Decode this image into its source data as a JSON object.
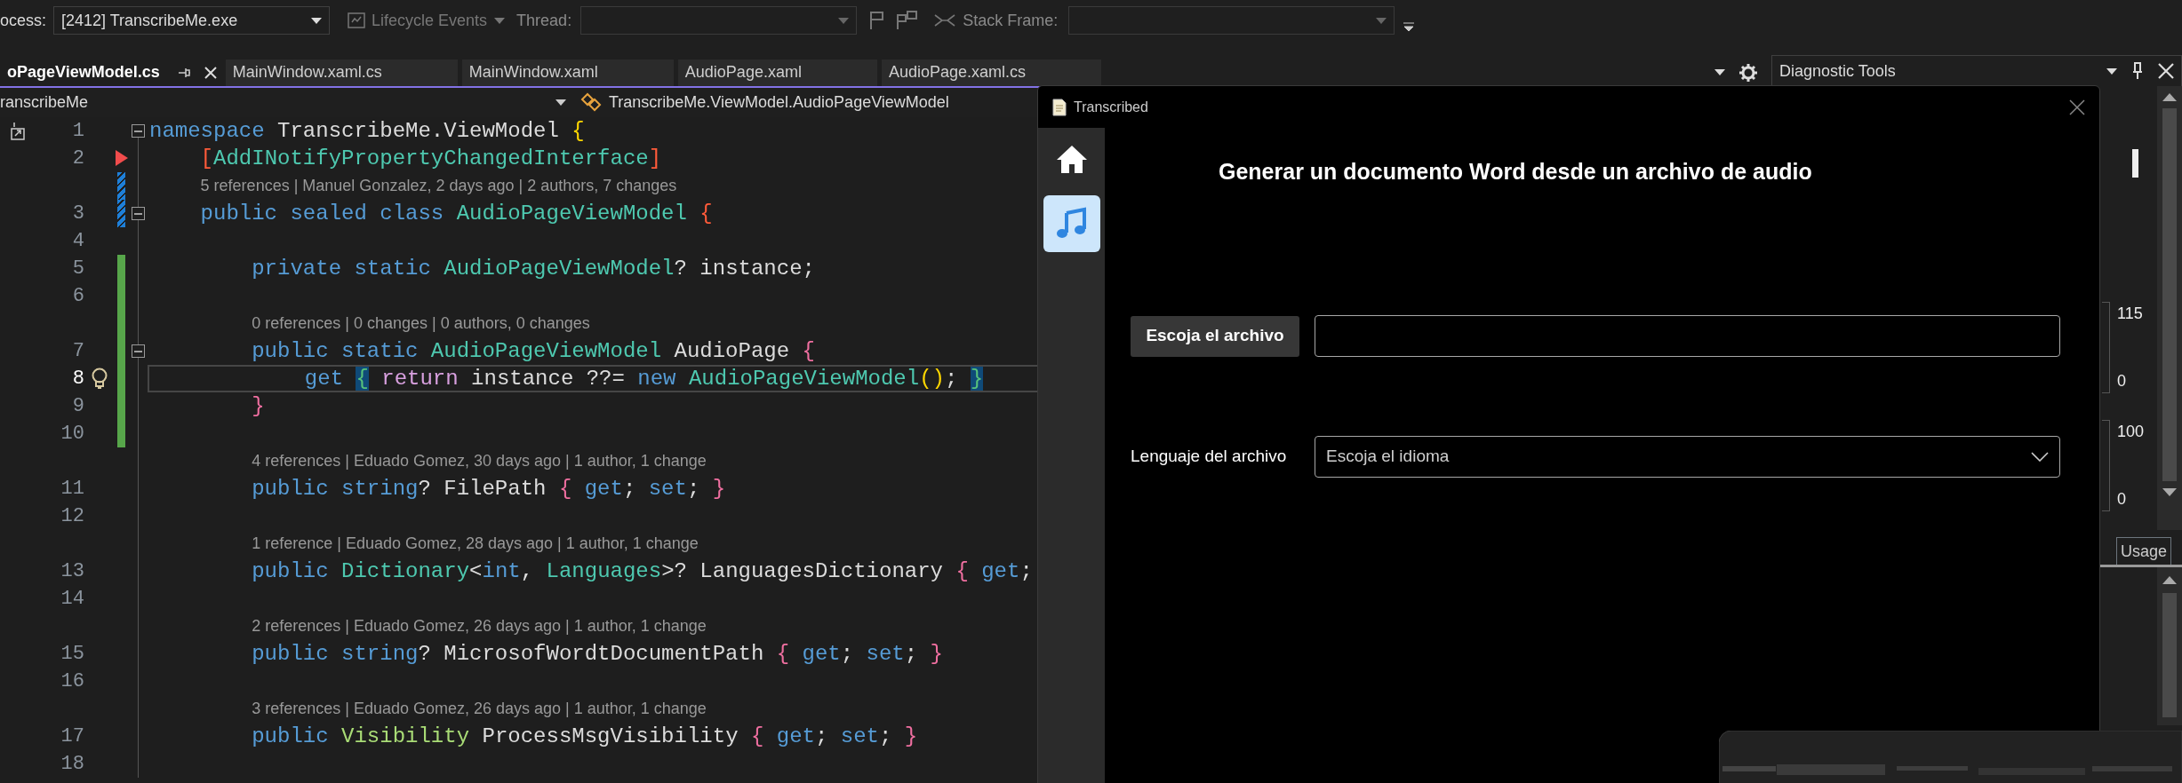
{
  "debug_toolbar": {
    "process": {
      "label": "ocess:",
      "value": "[2412] TranscribeMe.exe",
      "disabled": false
    },
    "lifecycle": {
      "label": "Lifecycle Events",
      "disabled": true
    },
    "thread": {
      "label": "Thread:",
      "disabled": true
    },
    "stack_frame": {
      "label": "Stack Frame:",
      "disabled": true
    }
  },
  "tabs": [
    {
      "label": "oPageViewModel.cs",
      "selected": true
    },
    {
      "label": "MainWindow.xaml.cs",
      "selected": false
    },
    {
      "label": "MainWindow.xaml",
      "selected": false
    },
    {
      "label": "AudioPage.xaml",
      "selected": false
    },
    {
      "label": "AudioPage.xaml.cs",
      "selected": false
    }
  ],
  "navigation": {
    "project": "ranscribeMe",
    "member": "TranscribeMe.ViewModel.AudioPageViewModel"
  },
  "code_lines": [
    {
      "number": "1",
      "collapsible": true,
      "tokens": [
        {
          "kind": "kw",
          "text": "namespace"
        },
        {
          "kind": "plain",
          "text": " TranscribeMe.ViewModel "
        },
        {
          "kind": "gold",
          "text": "{"
        }
      ]
    },
    {
      "number": "2",
      "arrow_marker": true,
      "tokens": [
        {
          "kind": "red",
          "text": "    ["
        },
        {
          "kind": "type",
          "text": "AddINotifyPropertyChangedInterface"
        },
        {
          "kind": "red",
          "text": "]"
        }
      ]
    },
    {
      "number": "3",
      "lens": "5 references | Manuel Gonzalez, 2 days ago | 2 authors, 7 changes",
      "change_modified": true,
      "collapsible": true,
      "tokens": [
        {
          "kind": "kw",
          "text": "    public sealed class "
        },
        {
          "kind": "type",
          "text": "AudioPageViewModel "
        },
        {
          "kind": "red",
          "text": "{"
        }
      ]
    },
    {
      "number": "4"
    },
    {
      "number": "5",
      "change_added": true,
      "tokens": [
        {
          "kind": "kw",
          "text": "        private static "
        },
        {
          "kind": "type",
          "text": "AudioPageViewModel"
        },
        {
          "kind": "plain",
          "text": "? instance;"
        }
      ]
    },
    {
      "number": "6",
      "change_added": true
    },
    {
      "number": "7",
      "lens": "0 references | 0 changes | 0 authors, 0 changes",
      "change_added": true,
      "collapsible": true,
      "tokens": [
        {
          "kind": "kw",
          "text": "        public static "
        },
        {
          "kind": "type",
          "text": "AudioPageViewModel"
        },
        {
          "kind": "plain",
          "text": " AudioPage "
        },
        {
          "kind": "pink",
          "text": "{"
        }
      ]
    },
    {
      "number": "8",
      "change_added": true,
      "current": true,
      "lightbulb": true,
      "tokens": [
        {
          "kind": "kw",
          "text": "            get "
        },
        {
          "kind": "match",
          "text": "{"
        },
        {
          "kind": "ctrl",
          "text": " return"
        },
        {
          "kind": "plain",
          "text": " instance ??= "
        },
        {
          "kind": "kw",
          "text": "new "
        },
        {
          "kind": "type",
          "text": "AudioPageViewModel"
        },
        {
          "kind": "gold",
          "text": "()"
        },
        {
          "kind": "plain",
          "text": "; "
        },
        {
          "kind": "match",
          "text": "}"
        }
      ]
    },
    {
      "number": "9",
      "change_added": true,
      "tokens": [
        {
          "kind": "pink",
          "text": "        }"
        }
      ]
    },
    {
      "number": "10",
      "change_added": true
    },
    {
      "number": "11",
      "lens": "4 references | Eduado Gomez, 30 days ago | 1 author, 1 change",
      "tokens": [
        {
          "kind": "kw",
          "text": "        public string"
        },
        {
          "kind": "plain",
          "text": "? FilePath "
        },
        {
          "kind": "pink",
          "text": "{"
        },
        {
          "kind": "kw",
          "text": " get"
        },
        {
          "kind": "plain",
          "text": "; "
        },
        {
          "kind": "kw",
          "text": "set"
        },
        {
          "kind": "plain",
          "text": "; "
        },
        {
          "kind": "pink",
          "text": "}"
        }
      ]
    },
    {
      "number": "12"
    },
    {
      "number": "13",
      "lens": "1 reference | Eduado Gomez, 28 days ago | 1 author, 1 change",
      "tokens": [
        {
          "kind": "kw",
          "text": "        public "
        },
        {
          "kind": "type",
          "text": "Dictionary"
        },
        {
          "kind": "plain",
          "text": "<"
        },
        {
          "kind": "kw",
          "text": "int"
        },
        {
          "kind": "plain",
          "text": ", "
        },
        {
          "kind": "type",
          "text": "Languages"
        },
        {
          "kind": "plain",
          "text": ">? LanguagesDictionary "
        },
        {
          "kind": "pink",
          "text": "{"
        },
        {
          "kind": "kw",
          "text": " get"
        },
        {
          "kind": "plain",
          "text": ";"
        }
      ]
    },
    {
      "number": "14"
    },
    {
      "number": "15",
      "lens": "2 references | Eduado Gomez, 26 days ago | 1 author, 1 change",
      "tokens": [
        {
          "kind": "kw",
          "text": "        public string"
        },
        {
          "kind": "plain",
          "text": "? MicrosofWordtDocumentPath "
        },
        {
          "kind": "pink",
          "text": "{"
        },
        {
          "kind": "kw",
          "text": " get"
        },
        {
          "kind": "plain",
          "text": "; "
        },
        {
          "kind": "kw",
          "text": "set"
        },
        {
          "kind": "plain",
          "text": "; "
        },
        {
          "kind": "pink",
          "text": "}"
        }
      ]
    },
    {
      "number": "16"
    },
    {
      "number": "17",
      "lens": "3 references | Eduado Gomez, 26 days ago | 1 author, 1 change",
      "tokens": [
        {
          "kind": "kw",
          "text": "        public "
        },
        {
          "kind": "struct",
          "text": "Visibility"
        },
        {
          "kind": "plain",
          "text": " ProcessMsgVisibility "
        },
        {
          "kind": "pink",
          "text": "{"
        },
        {
          "kind": "kw",
          "text": " get"
        },
        {
          "kind": "plain",
          "text": "; "
        },
        {
          "kind": "kw",
          "text": "set"
        },
        {
          "kind": "plain",
          "text": "; "
        },
        {
          "kind": "pink",
          "text": "}"
        }
      ]
    },
    {
      "number": "18"
    }
  ],
  "diagnostic_tools": {
    "title": "Diagnostic Tools",
    "graphs": [
      {
        "max": "115",
        "min": "0"
      },
      {
        "max": "100",
        "min": "0"
      }
    ],
    "tab": "Usage"
  },
  "app_window": {
    "title": "Transcribed",
    "nav": [
      {
        "kind": "home",
        "selected": false
      },
      {
        "kind": "music",
        "selected": true
      }
    ],
    "heading": "Generar un documento Word desde un archivo de audio",
    "file_button": "Escoja el archivo",
    "language_label": "Lenguaje del archivo",
    "language_select": {
      "placeholder": "Escoja el idioma"
    }
  }
}
